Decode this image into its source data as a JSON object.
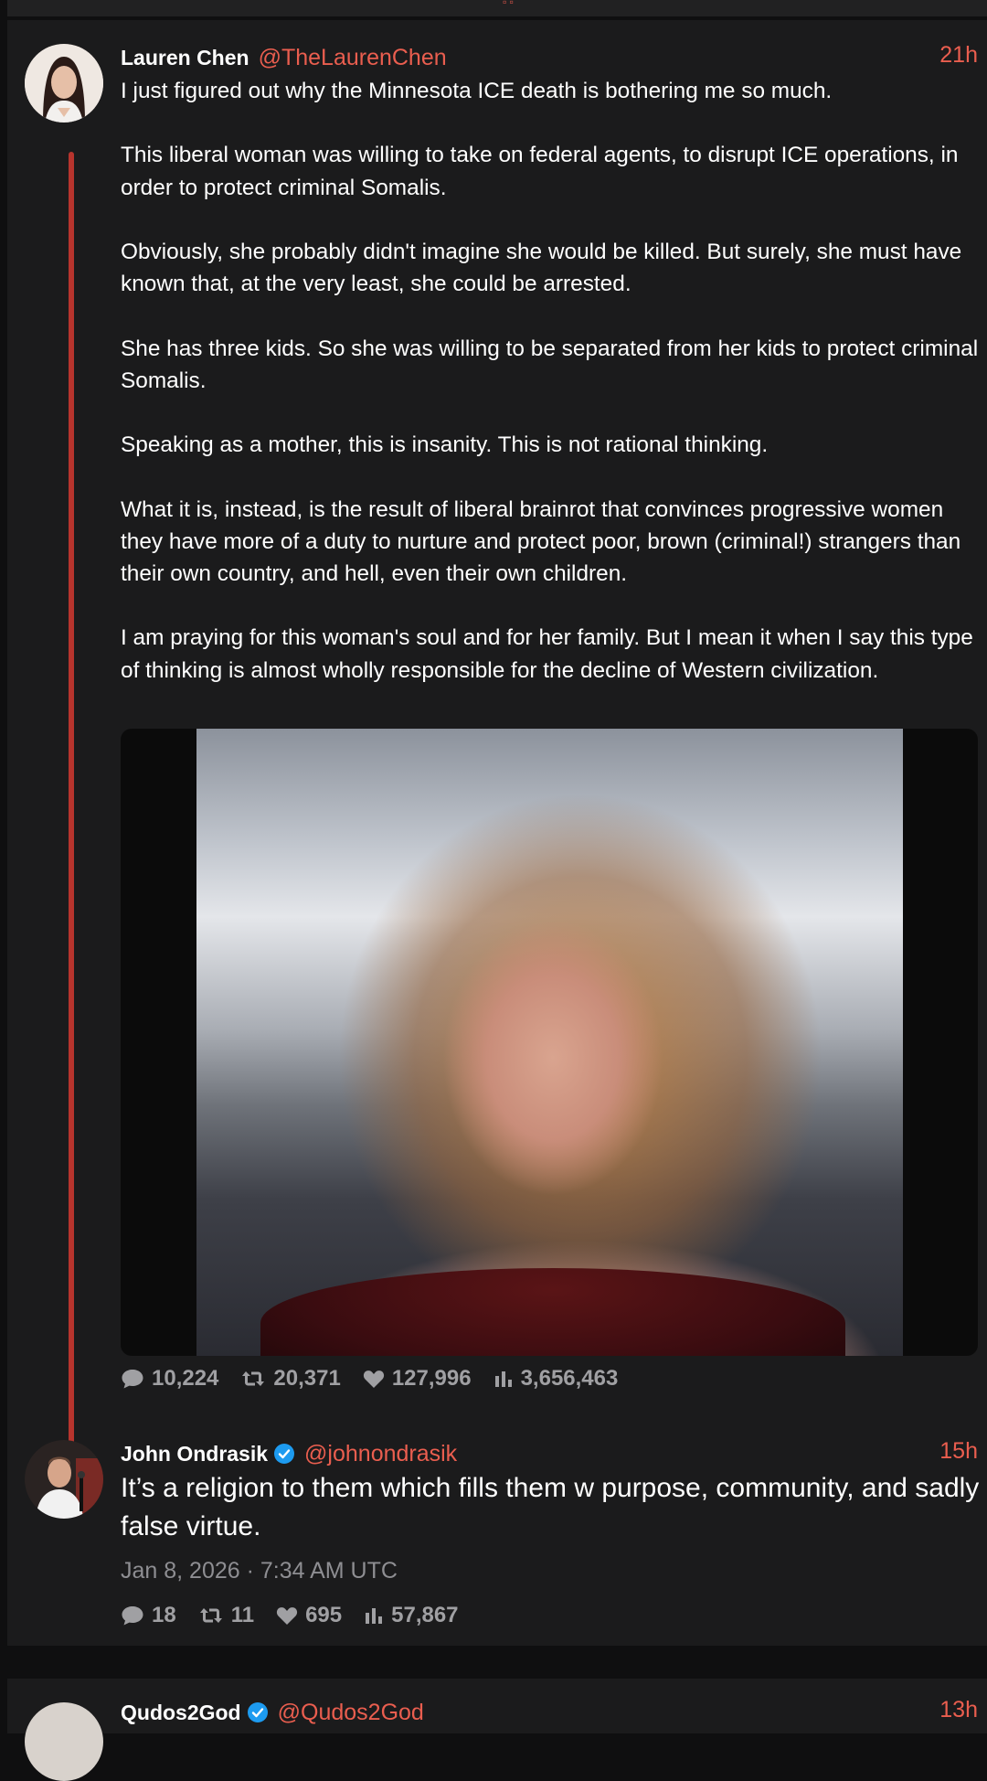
{
  "post": {
    "author_name": "Lauren Chen",
    "author_handle": "@TheLaurenChen",
    "time": "21h",
    "paragraphs": [
      "I just figured out why the Minnesota ICE death is bothering me so much.",
      "This liberal woman was willing to take on federal agents, to disrupt ICE operations, in order to protect criminal Somalis.",
      "Obviously, she probably didn't imagine she would be killed. But surely, she must have known that, at the very least, she could be arrested.",
      "She has three kids. So she was willing to be separated from her kids to protect criminal Somalis.",
      "Speaking as a mother, this is insanity. This is not rational thinking.",
      "What it is, instead, is the result of liberal brainrot that convinces progressive women they have more of a duty to nurture and protect poor, brown (criminal!) strangers than their own country, and hell, even their own children.",
      "I am praying for this woman's soul and for her family. But I mean it when I say this type of thinking is almost wholly responsible for the decline of Western civilization."
    ],
    "stats": {
      "replies": "10,224",
      "reposts": "20,371",
      "likes": "127,996",
      "views": "3,656,463"
    }
  },
  "reply": {
    "author_name": "John Ondrasik",
    "author_handle": "@johnondrasik",
    "time": "15h",
    "text": "It’s a religion to them which fills them w purpose, community, and sadly false virtue.",
    "date": "Jan 8, 2026 · 7:34 AM UTC",
    "stats": {
      "replies": "18",
      "reposts": "11",
      "likes": "695",
      "views": "57,867"
    }
  },
  "next_post": {
    "author_name": "Qudos2God",
    "author_handle": "@Qudos2God",
    "time": "13h"
  },
  "colors": {
    "accent": "#ea5e4f",
    "thread_line": "#b7342d",
    "verified": "#1d9bf0",
    "muted": "#a0a0a3"
  }
}
